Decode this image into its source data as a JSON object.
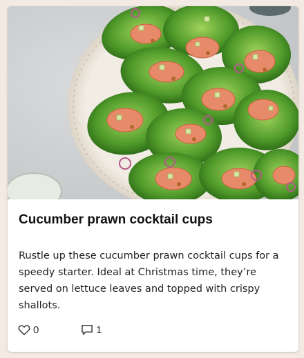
{
  "card": {
    "image_alt": "Lettuce cups topped with cucumber, prawns in cocktail sauce and crispy shallots on a round plate",
    "title": "Cucumber prawn cocktail cups",
    "description": "Rustle up these cucumber prawn cocktail cups for a speedy starter. Ideal at Christmas time, they’re served on lettuce leaves and topped with crispy shallots.",
    "likes": {
      "icon": "heart-outline-icon",
      "count": "0"
    },
    "comments": {
      "icon": "speech-bubble-icon",
      "count": "1"
    }
  },
  "colors": {
    "page_background": "#f3ebe3",
    "card_background": "#ffffff",
    "title_text": "#111111",
    "body_text": "#1f1f1f",
    "icon_color": "#444444"
  }
}
